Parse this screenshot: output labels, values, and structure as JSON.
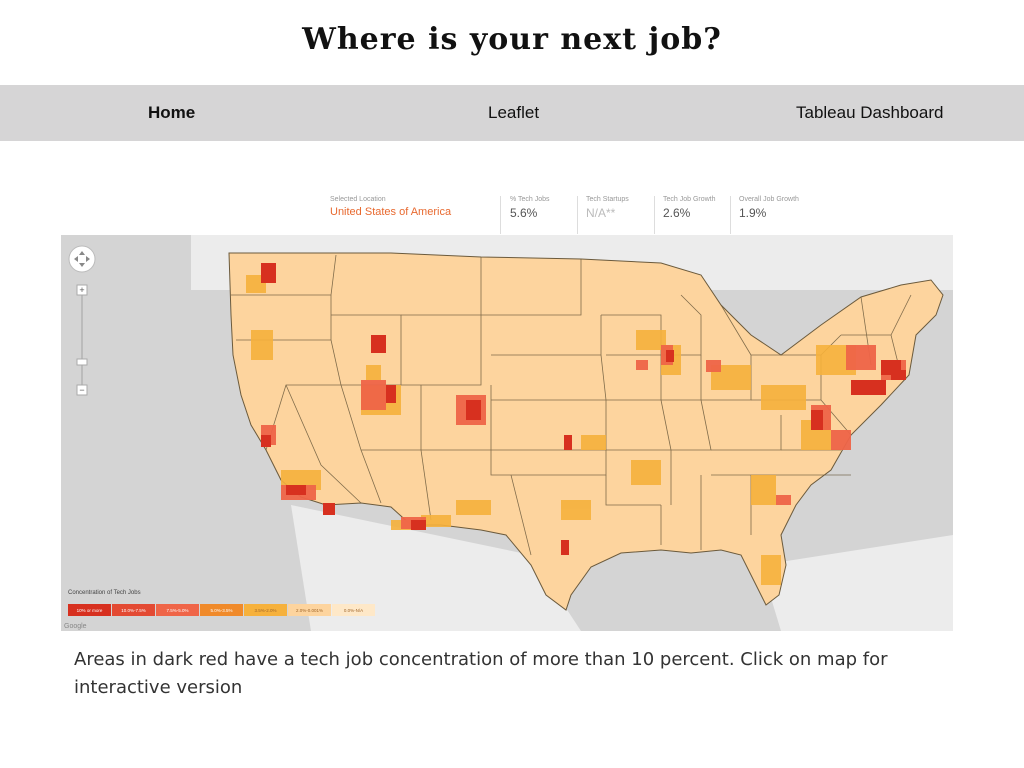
{
  "header": {
    "title": "Where is your next job?"
  },
  "nav": {
    "home": "Home",
    "leaflet": "Leaflet",
    "tableau": "Tableau Dashboard"
  },
  "stats": {
    "selected_location_label": "Selected Location",
    "selected_location_value": "United States of America",
    "tech_jobs_label": "% Tech Jobs",
    "tech_jobs_value": "5.6%",
    "tech_startups_label": "Tech Startups",
    "tech_startups_value": "N/A**",
    "tech_job_growth_label": "Tech Job Growth",
    "tech_job_growth_value": "2.6%",
    "overall_job_growth_label": "Overall Job Growth",
    "overall_job_growth_value": "1.9%"
  },
  "map": {
    "legend_title": "Concentration of Tech Jobs",
    "legend": [
      {
        "label": "10% or more",
        "color": "#d7301f"
      },
      {
        "label": "10.0%-7.5%",
        "color": "#e34a33"
      },
      {
        "label": "7.5%-5.0%",
        "color": "#ef6548"
      },
      {
        "label": "5.0%-3.5%",
        "color": "#f08a2a"
      },
      {
        "label": "3.5%-2.0%",
        "color": "#f6b13c"
      },
      {
        "label": "2.0%-0.001%",
        "color": "#fdd49e"
      },
      {
        "label": "0.0%-N/A",
        "color": "#fee8c8"
      }
    ],
    "attribution": "Google",
    "colors": {
      "water": "#d4d4d4",
      "land": "#ececec",
      "base": "#fdd49e",
      "border": "#6b5a3c"
    }
  },
  "caption": "Areas in dark red have a tech job concentration of more than 10 percent. Click on map for interactive version"
}
